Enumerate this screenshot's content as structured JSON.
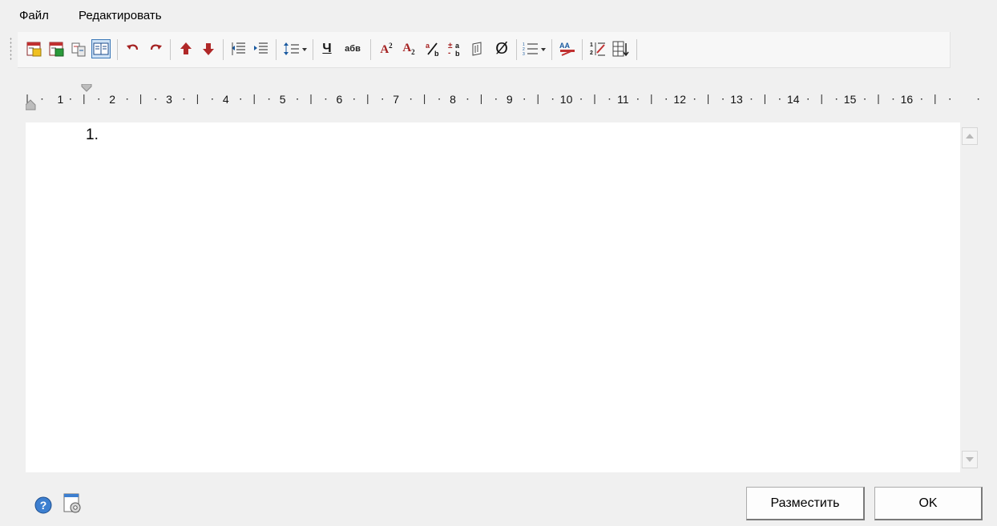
{
  "menu": {
    "file": "Файл",
    "edit": "Редактировать"
  },
  "toolbar": {
    "icons": [
      "import-text-icon",
      "export-text-icon",
      "find-replace-icon",
      "text-mode-book-icon",
      "undo-icon",
      "redo-icon",
      "move-up-icon",
      "move-down-icon",
      "decrease-indent-icon",
      "increase-indent-icon",
      "line-spacing-icon",
      "underline-icon",
      "lowercase-icon",
      "superscript-icon",
      "subscript-icon",
      "fraction-icon",
      "stack-icon",
      "symbol-icon",
      "diameter-icon",
      "numbering-icon",
      "spell-check-icon",
      "insert-field-icon",
      "sort-icon"
    ],
    "underline_label": "Ч",
    "lowercase_label": "абв",
    "superscript_label": "A",
    "superscript_sup": "2",
    "subscript_label": "A",
    "subscript_sub": "2",
    "diameter_label": "Ø",
    "accent_color": "#a42020"
  },
  "ruler": {
    "labels": [
      "1",
      "2",
      "3",
      "4",
      "5",
      "6",
      "7",
      "8",
      "9",
      "10",
      "11",
      "12",
      "13",
      "14",
      "15",
      "16"
    ]
  },
  "editor": {
    "line1": "1."
  },
  "buttons": {
    "place": "Разместить",
    "ok": "OK"
  }
}
